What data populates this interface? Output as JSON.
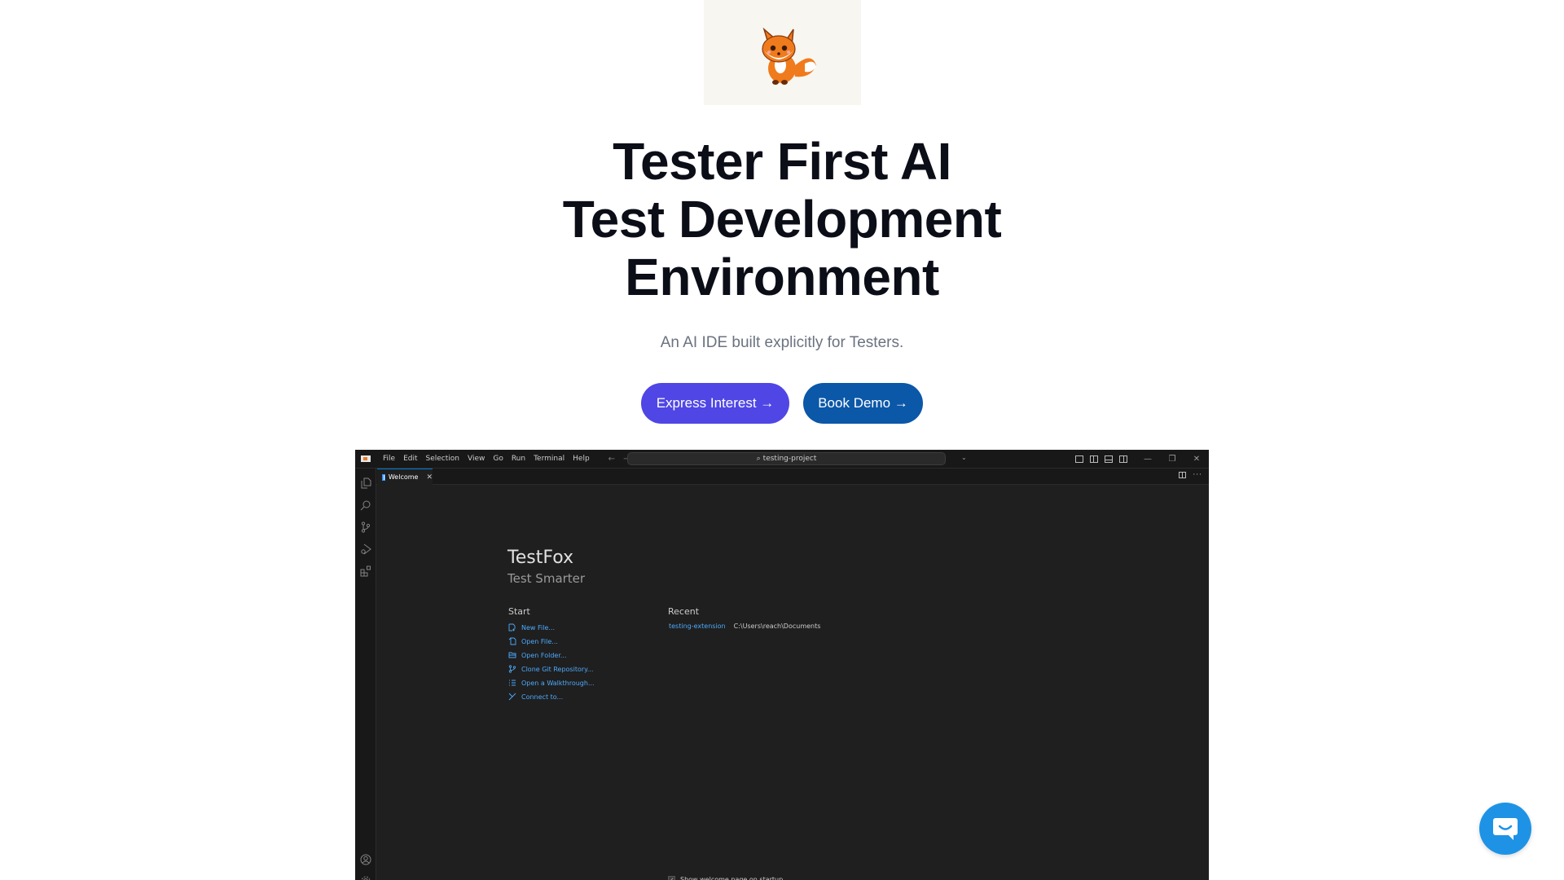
{
  "hero": {
    "image_alt": "Cartoon fox mascot",
    "title_lines": [
      "Tester First AI",
      "Test Development",
      "Environment"
    ],
    "subtitle": "An AI IDE built explicitly for Testers.",
    "buttons": {
      "express_interest": "Express Interest →",
      "book_demo": "Book Demo →"
    },
    "colors": {
      "primary_button": "#4f46e5",
      "secondary_button": "#0b57a8",
      "title": "#0b0d17",
      "subtitle": "#6b7280"
    }
  },
  "ide": {
    "menu": [
      "File",
      "Edit",
      "Selection",
      "View",
      "Go",
      "Run",
      "Terminal",
      "Help"
    ],
    "command_center": "testing-project",
    "window_controls": {
      "minimize": "—",
      "restore": "❐",
      "close": "✕"
    },
    "tab": {
      "label": "Welcome",
      "close": "✕"
    },
    "editor_more": "···",
    "welcome": {
      "title": "TestFox",
      "subtitle": "Test Smarter",
      "start_heading": "Start",
      "start_items": [
        {
          "label": "New File...",
          "icon": "new-file-icon"
        },
        {
          "label": "Open File...",
          "icon": "open-file-icon"
        },
        {
          "label": "Open Folder...",
          "icon": "folder-icon"
        },
        {
          "label": "Clone Git Repository...",
          "icon": "git-branch-icon"
        },
        {
          "label": "Open a Walkthrough...",
          "icon": "list-icon"
        },
        {
          "label": "Connect to...",
          "icon": "remote-icon"
        }
      ],
      "recent_heading": "Recent",
      "recent_items": [
        {
          "name": "testing-extension",
          "path": "C:\\Users\\reach\\Documents"
        }
      ],
      "show_on_startup": "Show welcome page on startup",
      "show_on_startup_checked": true
    },
    "colors": {
      "link": "#4daafc",
      "editor_bg": "#1f1f1f",
      "chrome_bg": "#181818",
      "active_tab_border": "#0078d4"
    }
  },
  "chat_widget": {
    "color": "#1e93e6"
  }
}
